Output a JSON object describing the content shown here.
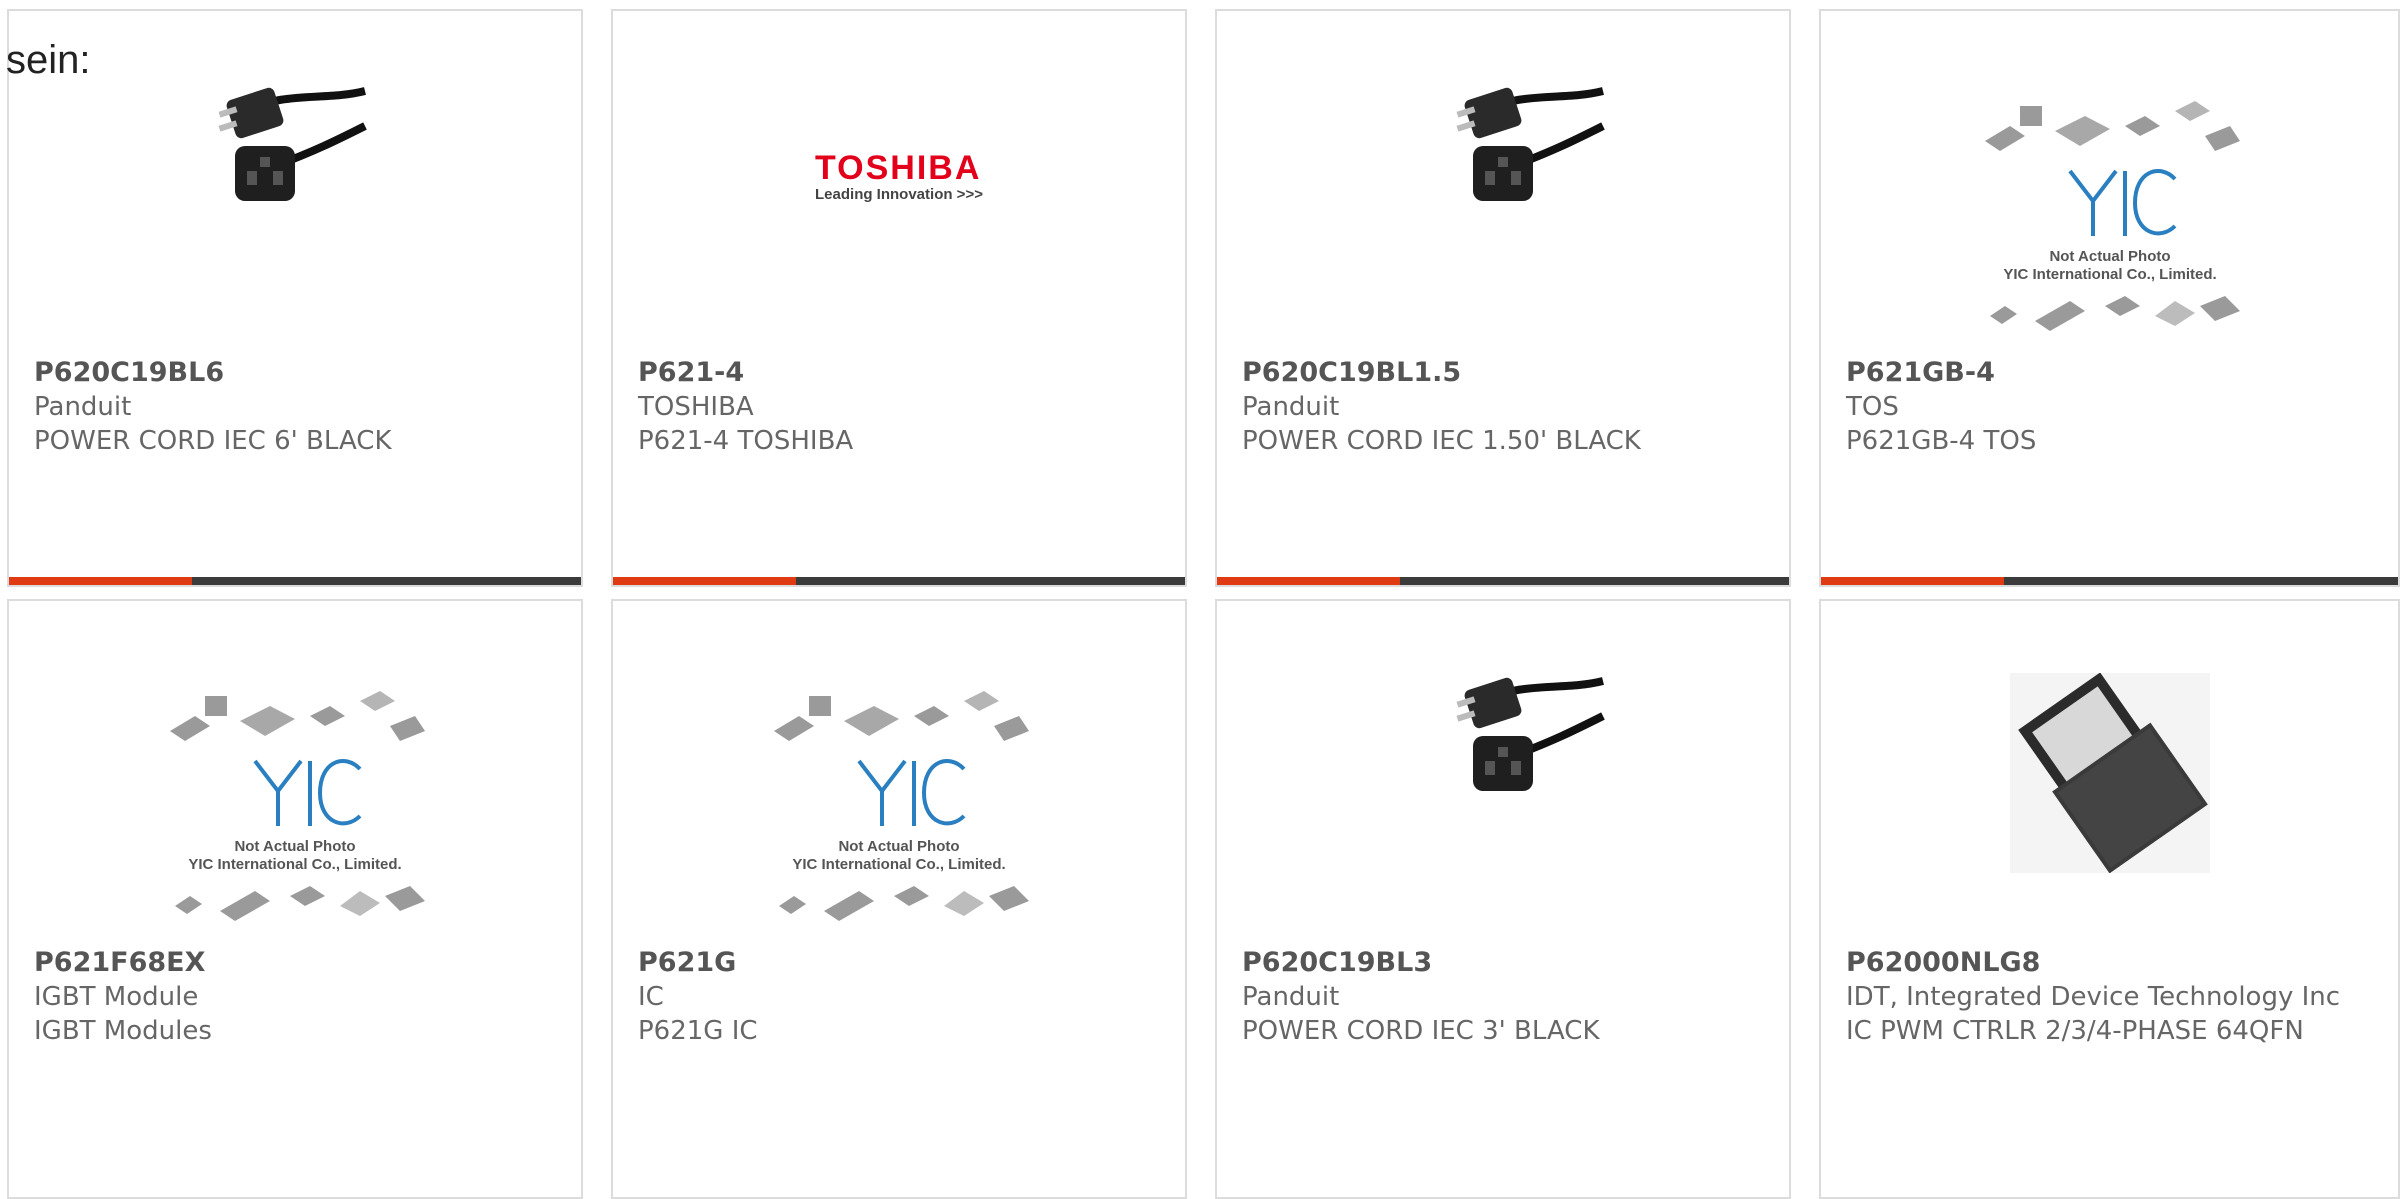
{
  "intro_text": "sein:",
  "brand_colors": {
    "accent": "#e03a12",
    "bar": "#3b3b3b",
    "border": "#dcdcdc"
  },
  "products": [
    {
      "part": "P620C19BL6",
      "maker": "Panduit",
      "desc": "POWER CORD IEC 6' BLACK",
      "image": "power-cord-icon"
    },
    {
      "part": "P621-4",
      "maker": "TOSHIBA",
      "desc": "P621-4 TOSHIBA",
      "image": "toshiba-logo",
      "logo_text": "TOSHIBA",
      "logo_tagline": "Leading Innovation >>>"
    },
    {
      "part": "P620C19BL1.5",
      "maker": "Panduit",
      "desc": "POWER CORD IEC 1.50' BLACK",
      "image": "power-cord-icon"
    },
    {
      "part": "P621GB-4",
      "maker": "TOS",
      "desc": "P621GB-4 TOS",
      "image": "not-actual-photo-placeholder",
      "ph_line1": "Not Actual Photo",
      "ph_line2": "YIC International Co., Limited."
    },
    {
      "part": "P621F68EX",
      "maker": "IGBT Module",
      "desc": "IGBT Modules",
      "image": "not-actual-photo-placeholder",
      "ph_line1": "Not Actual Photo",
      "ph_line2": "YIC International Co., Limited."
    },
    {
      "part": "P621G",
      "maker": "IC",
      "desc": "P621G IC",
      "image": "not-actual-photo-placeholder",
      "ph_line1": "Not Actual Photo",
      "ph_line2": "YIC International Co., Limited."
    },
    {
      "part": "P620C19BL3",
      "maker": "Panduit",
      "desc": "POWER CORD IEC 3' BLACK",
      "image": "power-cord-icon"
    },
    {
      "part": "P62000NLG8",
      "maker": "IDT, Integrated Device Technology Inc",
      "desc": "IC PWM CTRLR 2/3/4-PHASE 64QFN",
      "image": "qfn-chip-icon"
    }
  ]
}
